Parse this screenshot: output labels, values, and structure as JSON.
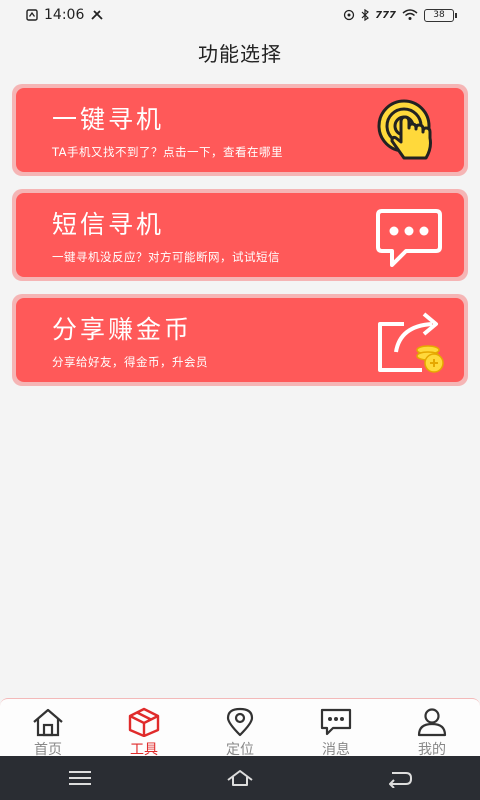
{
  "status_bar": {
    "time": "14:06",
    "network_label": "777",
    "battery": "38"
  },
  "page": {
    "title": "功能选择"
  },
  "cards": [
    {
      "title": "一键寻机",
      "subtitle": "TA手机又找不到了？点击一下，查看在哪里",
      "icon": "tap-hand-icon"
    },
    {
      "title": "短信寻机",
      "subtitle": "一键寻机没反应？对方可能断网，试试短信",
      "icon": "sms-bubble-icon"
    },
    {
      "title": "分享赚金币",
      "subtitle": "分享给好友，得金币，升会员",
      "icon": "share-coins-icon"
    }
  ],
  "tab_bar": {
    "tabs": [
      {
        "label": "首页",
        "icon": "home-icon",
        "active": false
      },
      {
        "label": "工具",
        "icon": "toolbox-icon",
        "active": true
      },
      {
        "label": "定位",
        "icon": "location-pin-icon",
        "active": false
      },
      {
        "label": "消息",
        "icon": "message-icon",
        "active": false
      },
      {
        "label": "我的",
        "icon": "user-icon",
        "active": false
      }
    ]
  },
  "colors": {
    "card_red": "#ff5959",
    "card_border": "#f5b5b5",
    "active_tab": "#e02b2b",
    "inactive_tab": "#888888",
    "nav_bar": "#2a2d33"
  }
}
